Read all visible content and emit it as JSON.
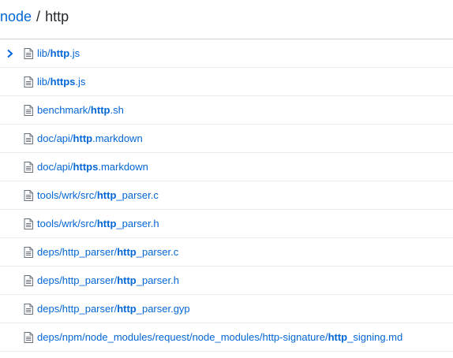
{
  "breadcrumb": {
    "repo": "node",
    "separator": "/",
    "query": "http"
  },
  "results": [
    {
      "prefix": "lib/",
      "match": "http",
      "suffix": ".js",
      "selected": true
    },
    {
      "prefix": "lib/",
      "match": "https",
      "suffix": ".js"
    },
    {
      "prefix": "benchmark/",
      "match": "http",
      "suffix": ".sh"
    },
    {
      "prefix": "doc/api/",
      "match": "http",
      "suffix": ".markdown"
    },
    {
      "prefix": "doc/api/",
      "match": "https",
      "suffix": ".markdown"
    },
    {
      "prefix": "tools/wrk/src/",
      "match": "http",
      "suffix": "_parser.c"
    },
    {
      "prefix": "tools/wrk/src/",
      "match": "http",
      "suffix": "_parser.h"
    },
    {
      "prefix": "deps/http_parser/",
      "match": "http",
      "suffix": "_parser.c"
    },
    {
      "prefix": "deps/http_parser/",
      "match": "http",
      "suffix": "_parser.h"
    },
    {
      "prefix": "deps/http_parser/",
      "match": "http",
      "suffix": "_parser.gyp"
    },
    {
      "prefix": "deps/npm/node_modules/request/node_modules/http-signature/",
      "match": "http",
      "suffix": "_signing.md"
    }
  ],
  "icons": {
    "selected_row": "chevron-right-icon",
    "file": "file-text-icon"
  },
  "colors": {
    "link": "#0366d6",
    "text": "#24292e",
    "icon": "#6a737d",
    "divider": "#eaecef"
  }
}
